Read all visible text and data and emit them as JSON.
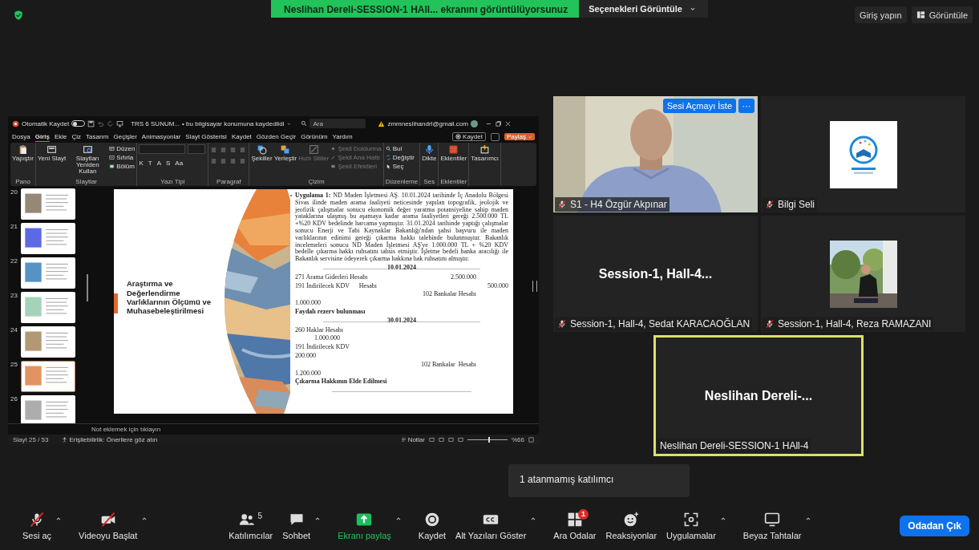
{
  "top_bar": {
    "banner": "Neslihan Dereli-SESSION-1 HAll... ekranını görüntülüyorsunuz",
    "options": "Seçenekleri Görüntüle",
    "sign_in": "Giriş yapın",
    "view": "Görüntüle"
  },
  "shared_screen": {
    "title_bar": {
      "autosave": "Otomatik Kaydet",
      "autosave_on": false,
      "file": "TRS 6 SUNUM...",
      "save_state": "• bu bilgisayar konumuna kaydedildi",
      "search_placeholder": "Ara",
      "account": "zmmneslihandrl@gmail.com"
    },
    "ribbon_tabs": [
      {
        "label": "Dosya",
        "selected": false
      },
      {
        "label": "Giriş",
        "selected": true
      },
      {
        "label": "Ekle",
        "selected": false
      },
      {
        "label": "Çiz",
        "selected": false
      },
      {
        "label": "Tasarım",
        "selected": false
      },
      {
        "label": "Geçişler",
        "selected": false
      },
      {
        "label": "Animasyonlar",
        "selected": false
      },
      {
        "label": "Slayt Gösterisi",
        "selected": false
      },
      {
        "label": "Kaydet",
        "selected": false
      },
      {
        "label": "Gözden Geçir",
        "selected": false
      },
      {
        "label": "Görünüm",
        "selected": false
      },
      {
        "label": "Yardım",
        "selected": false
      }
    ],
    "ribbon_actions": {
      "record": "Kaydet",
      "share": "Paylaş"
    },
    "ribbon_groups": [
      {
        "label": "Pano",
        "buttons": [
          {
            "label": "Yapıştır",
            "kind": "large",
            "disabled": false
          }
        ]
      },
      {
        "label": "Slaytlar",
        "buttons": [
          {
            "label": "Yeni Slayt",
            "kind": "large",
            "disabled": false
          },
          {
            "label": "Slaytları Yeniden Kullan",
            "kind": "large",
            "disabled": false
          },
          {
            "label": "Düzen",
            "kind": "small",
            "disabled": false
          },
          {
            "label": "Sıfırla",
            "kind": "small",
            "disabled": false
          },
          {
            "label": "Bölüm",
            "kind": "small",
            "disabled": false
          }
        ]
      },
      {
        "label": "Yazı Tipi",
        "buttons": [
          {
            "label": "K",
            "kind": "glyph",
            "disabled": false
          },
          {
            "label": "T",
            "kind": "glyph",
            "disabled": false
          },
          {
            "label": "A",
            "kind": "glyph",
            "disabled": false
          },
          {
            "label": "S",
            "kind": "glyph",
            "disabled": false
          },
          {
            "label": "Aa",
            "kind": "glyph",
            "disabled": false
          }
        ]
      },
      {
        "label": "Paragraf"
      },
      {
        "label": "Çizim",
        "buttons": [
          {
            "label": "Şekiller",
            "kind": "large",
            "disabled": false
          },
          {
            "label": "Yerleştir",
            "kind": "large",
            "disabled": false
          },
          {
            "label": "Hızlı Stiller",
            "kind": "large",
            "disabled": true
          },
          {
            "label": "Şekil Doldurma",
            "kind": "small",
            "disabled": true
          },
          {
            "label": "Şekil Ana Hattı",
            "kind": "small",
            "disabled": true
          },
          {
            "label": "Şekil Efektleri",
            "kind": "small",
            "disabled": true
          }
        ]
      },
      {
        "label": "Düzenleme",
        "buttons": [
          {
            "label": "Bul",
            "kind": "small",
            "disabled": false
          },
          {
            "label": "Değiştir",
            "kind": "small",
            "disabled": false
          },
          {
            "label": "Seç",
            "kind": "small",
            "disabled": false
          }
        ]
      },
      {
        "label": "Ses",
        "buttons": [
          {
            "label": "Dikte",
            "kind": "large",
            "disabled": false
          }
        ]
      },
      {
        "label": "Eklentiler",
        "buttons": [
          {
            "label": "Eklentiler",
            "kind": "large",
            "disabled": false
          }
        ]
      },
      {
        "buttons": [
          {
            "label": "Tasarımcı",
            "kind": "large",
            "disabled": false
          }
        ]
      }
    ],
    "thumbnails": [
      {
        "number": "20",
        "selected": false
      },
      {
        "number": "21",
        "selected": false
      },
      {
        "number": "22",
        "selected": false
      },
      {
        "number": "23",
        "selected": false
      },
      {
        "number": "24",
        "selected": false
      },
      {
        "number": "25",
        "selected": true
      },
      {
        "number": "26",
        "selected": false
      }
    ],
    "slide": {
      "title_lines": [
        "Araştırma ve",
        "Değerlendirme",
        "Varlıklarının Ölçümü ve",
        "Muhasebeleştirilmesi"
      ],
      "body": [
        {
          "kind": "paragraph",
          "text": "**Uygulama 1:** ND Maden İşletmesi AŞ. 10.01.2024 tarihinde İç Anadolu Bölgesi Sivas ilinde maden arama faaliyeti neticesinde yapılan topografik, jeolojik ve jeofizik çalışmalar sonucu ekonomik değer yaratma potansiyeline sahip maden yataklarına ulaşmış bu aşamaya kadar arama faaliyetleri gereği 2.500.000 TL +%20 KDV bedelinde harcama yapmıştır. 31.01.2024 tarihinde yaptığı çalışmalar sonucu Enerji ve Tabi Kaynaklar Bakanlığı'ndan şahsi başvuru ile maden varlıklarının edinimi gereği çıkarma hakkı talebinde bulunmuştur. Bakanlık incelemeleri sonucu ND Maden İşletmesi AŞ'ye 1.000.000 TL + %20 KDV bedelle çıkarma hakkı ruhsatını tahsis etmiştir. İşletme bedeli banka aracılığı ile Bakanlık servisine ödeyerek çıkarma hakkına hak ruhsatını almıştır."
        },
        {
          "kind": "date_line",
          "text": "........................................**10.01.2024**........................................"
        },
        {
          "kind": "row",
          "c1": "271 Arama Giderleri Hesabı",
          "c2": "2.500.000"
        },
        {
          "kind": "row",
          "c1": "191 İndirilecek KDV      Hesabı",
          "c3": "500.000"
        },
        {
          "kind": "row",
          "c2": "102 Bankalar Hesabı"
        },
        {
          "kind": "row",
          "c1": "1.000.000"
        },
        {
          "kind": "heading",
          "text": "Faydalı rezerv bulunması"
        },
        {
          "kind": "date_line",
          "text": "........................................**30.01.2024**........................................"
        },
        {
          "kind": "row",
          "c1": "260 Haklar Hesabı"
        },
        {
          "kind": "indent",
          "text": "1.000.000"
        },
        {
          "kind": "row",
          "c1": "191 İndirilecek KDV"
        },
        {
          "kind": "row",
          "c1": "200.000"
        },
        {
          "kind": "row",
          "c2": "102 Bankalar  Hesabı"
        },
        {
          "kind": "row",
          "c1": "1.200.000"
        },
        {
          "kind": "heading",
          "text": "Çıkarma Hakkının Elde Edilmesi"
        },
        {
          "kind": "date_line",
          "text": "......................................................................................."
        }
      ]
    },
    "notes_placeholder": "Not eklemek için tıklayın",
    "status_bar": {
      "slide": "Slayt 25 / 53",
      "accessibility": "Erişilebilirlik: Önerilere göz atın",
      "notes": "Notlar",
      "zoom_slider": {
        "level": 0.55
      },
      "zoom": "%66"
    }
  },
  "gallery": [
    {
      "kind": "video",
      "name": "S1 - H4 Özgür Akpınar",
      "muted": true,
      "speaking": false,
      "actions": [
        "Sesi Açmayı İste",
        "···"
      ]
    },
    {
      "kind": "picture",
      "name": "Bilgi Seli",
      "muted": true,
      "speaking": false
    },
    {
      "kind": "text",
      "display": "Session-1,  Hall-4...",
      "name": "Session-1, Hall-4, Sedat KARACAOĞLAN",
      "muted": true,
      "speaking": false
    },
    {
      "kind": "picture",
      "name": "Session-1, Hall-4, Reza RAMAZANI",
      "muted": true,
      "speaking": false
    },
    {
      "kind": "text",
      "display": "Neslihan Dereli-...",
      "name": "Neslihan Dereli-SESSION-1 HAll-4",
      "muted": false,
      "speaking": true
    }
  ],
  "tooltip": "1 atanmamış katılımcı",
  "toolbar": {
    "items": [
      {
        "label": "Sesi aç",
        "caret": true,
        "crossed": true,
        "active": false
      },
      {
        "label": "Videoyu Başlat",
        "caret": true,
        "crossed": true,
        "active": false
      },
      {
        "label": "Katılımcılar",
        "caret": false,
        "crossed": false,
        "active": false,
        "count": "5"
      },
      {
        "label": "Sohbet",
        "caret": true,
        "crossed": false,
        "active": false
      },
      {
        "label": "Ekranı paylaş",
        "caret": true,
        "crossed": false,
        "active": true
      },
      {
        "label": "Kaydet",
        "caret": false,
        "crossed": false,
        "active": false
      },
      {
        "label": "Alt Yazıları Göster",
        "caret": true,
        "crossed": false,
        "active": false
      },
      {
        "label": "Ara Odalar",
        "caret": false,
        "crossed": false,
        "active": false,
        "badge": "1"
      },
      {
        "label": "Reaksiyonlar",
        "caret": false,
        "crossed": false,
        "active": false
      },
      {
        "label": "Uygulamalar",
        "caret": true,
        "crossed": false,
        "active": false
      },
      {
        "label": "Beyaz Tahtalar",
        "caret": true,
        "crossed": false,
        "active": false
      }
    ],
    "leave": "Odadan Çık"
  }
}
